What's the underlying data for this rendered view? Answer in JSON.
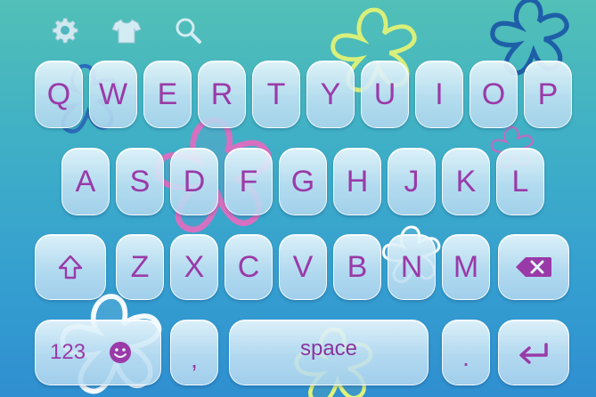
{
  "keyboard": {
    "rows": [
      [
        "Q",
        "W",
        "E",
        "R",
        "T",
        "Y",
        "U",
        "I",
        "O",
        "P"
      ],
      [
        "A",
        "S",
        "D",
        "F",
        "G",
        "H",
        "J",
        "K",
        "L"
      ],
      [
        "Z",
        "X",
        "C",
        "V",
        "B",
        "N",
        "M"
      ]
    ],
    "numbers_label": "123",
    "comma_label": ",",
    "space_label": "space",
    "period_label": "."
  },
  "colors": {
    "key_text": "#9a3aa8",
    "accent_purple": "#9a3aa8",
    "bg_top": "#52c0b6",
    "bg_bottom": "#2f8fd0"
  },
  "icons": {
    "toolbar": [
      "gear-icon",
      "shirt-icon",
      "search-icon"
    ],
    "keys": [
      "shift-icon",
      "backspace-icon",
      "emoji-icon",
      "enter-icon"
    ]
  }
}
